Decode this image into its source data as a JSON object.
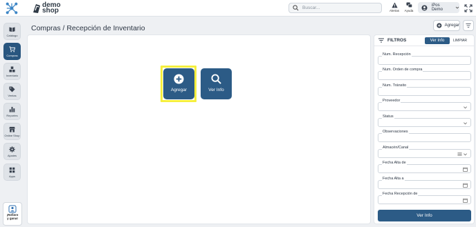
{
  "topbar": {
    "brand_line1": "demo",
    "brand_line2": "shop",
    "search_placeholder": "Buscar...",
    "alerts_label": "Alertas",
    "help_label": "Ayuda",
    "user_name": "iPos Demo"
  },
  "sidebar": {
    "items": [
      {
        "label": "Catálogo",
        "icon": "book-icon"
      },
      {
        "label": "Compras",
        "icon": "cart-icon",
        "active": true
      },
      {
        "label": "Inventario",
        "icon": "boxes-icon"
      },
      {
        "label": "Ventas",
        "icon": "tag-icon"
      },
      {
        "label": "Reportes",
        "icon": "bar-chart-icon"
      },
      {
        "label": "Online Shop",
        "icon": "store-icon"
      },
      {
        "label": "Ajustes",
        "icon": "gear-icon"
      },
      {
        "label": "Apps",
        "icon": "apps-icon"
      }
    ],
    "refer_line1": "¡Refiere",
    "refer_line2": "y gana!"
  },
  "header": {
    "title": "Compras / Recepción de Inventario",
    "add_label": "Agregar"
  },
  "main": {
    "add_action_label": "Agregar",
    "info_action_label": "Ver Info"
  },
  "filters": {
    "title": "FILTROS",
    "view_info_label": "Ver Info",
    "clear_label": "LIMPIAR",
    "fields": [
      {
        "label": "Num. Recepción"
      },
      {
        "label": "Num. Orden de compra"
      },
      {
        "label": "Num. Tránsito"
      },
      {
        "label": "Proveedor"
      },
      {
        "label": "Status"
      },
      {
        "label": "Observaciones"
      },
      {
        "label": "Almacén/Canal"
      },
      {
        "label": "Fecha Alta de"
      },
      {
        "label": "Fecha Alta a"
      },
      {
        "label": "Fecha Recepción de"
      }
    ],
    "submit_label": "Ver Info"
  },
  "colors": {
    "primary": "#2c5b86",
    "highlight": "#f5ef3d",
    "background": "#eef0f3"
  }
}
